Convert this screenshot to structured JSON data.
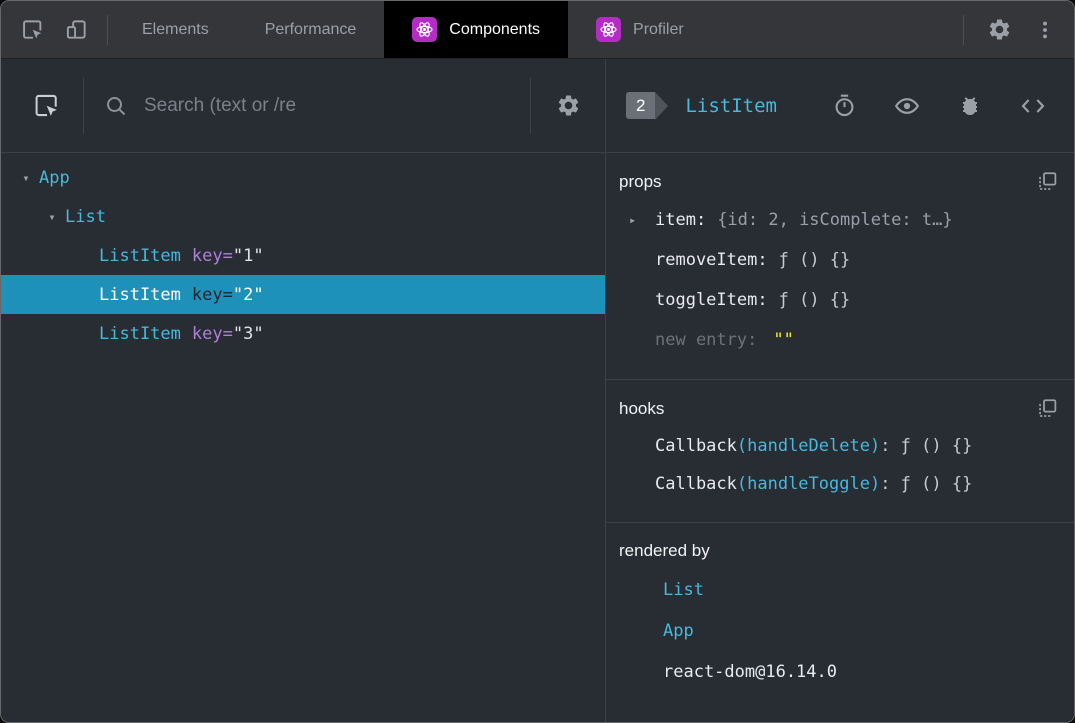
{
  "colors": {
    "accent_cyan": "#46b9dd",
    "attr_purple": "#b07fd8",
    "selected_row_bg": "#1e91bb",
    "react_icon_purple": "#b32dc4",
    "editable_value_yellow": "#f0f020"
  },
  "tabbar": {
    "tabs": [
      {
        "label": "Elements"
      },
      {
        "label": "Performance"
      },
      {
        "label": "Components"
      },
      {
        "label": "Profiler"
      }
    ]
  },
  "left": {
    "search_placeholder": "Search (text or /re",
    "tree": {
      "rows": [
        {
          "expander": "▾",
          "name": "App"
        },
        {
          "expander": "▾",
          "name": "List"
        },
        {
          "name": "ListItem",
          "key_attr": "key=",
          "key_value": "\"1\""
        },
        {
          "name": "ListItem",
          "key_attr": "key=",
          "key_value": "\"2\""
        },
        {
          "name": "ListItem",
          "key_attr": "key=",
          "key_value": "\"3\""
        }
      ]
    }
  },
  "right": {
    "badge": "2",
    "title": "ListItem",
    "props": {
      "heading": "props",
      "rows": [
        {
          "expander": "▸",
          "name": "item:",
          "value": "{id: 2, isComplete: t…}"
        },
        {
          "name": "removeItem:",
          "value": "ƒ () {}"
        },
        {
          "name": "toggleItem:",
          "value": "ƒ () {}"
        },
        {
          "name": "new entry:",
          "value": "\"\""
        }
      ]
    },
    "hooks": {
      "heading": "hooks",
      "rows": [
        {
          "fn": "Callback",
          "arg": "(handleDelete)",
          "value": ": ƒ () {}"
        },
        {
          "fn": "Callback",
          "arg": "(handleToggle)",
          "value": ": ƒ () {}"
        }
      ]
    },
    "rendered_by": {
      "heading": "rendered by",
      "items": [
        {
          "label": "List"
        },
        {
          "label": "App"
        },
        {
          "label": "react-dom@16.14.0"
        }
      ]
    }
  }
}
